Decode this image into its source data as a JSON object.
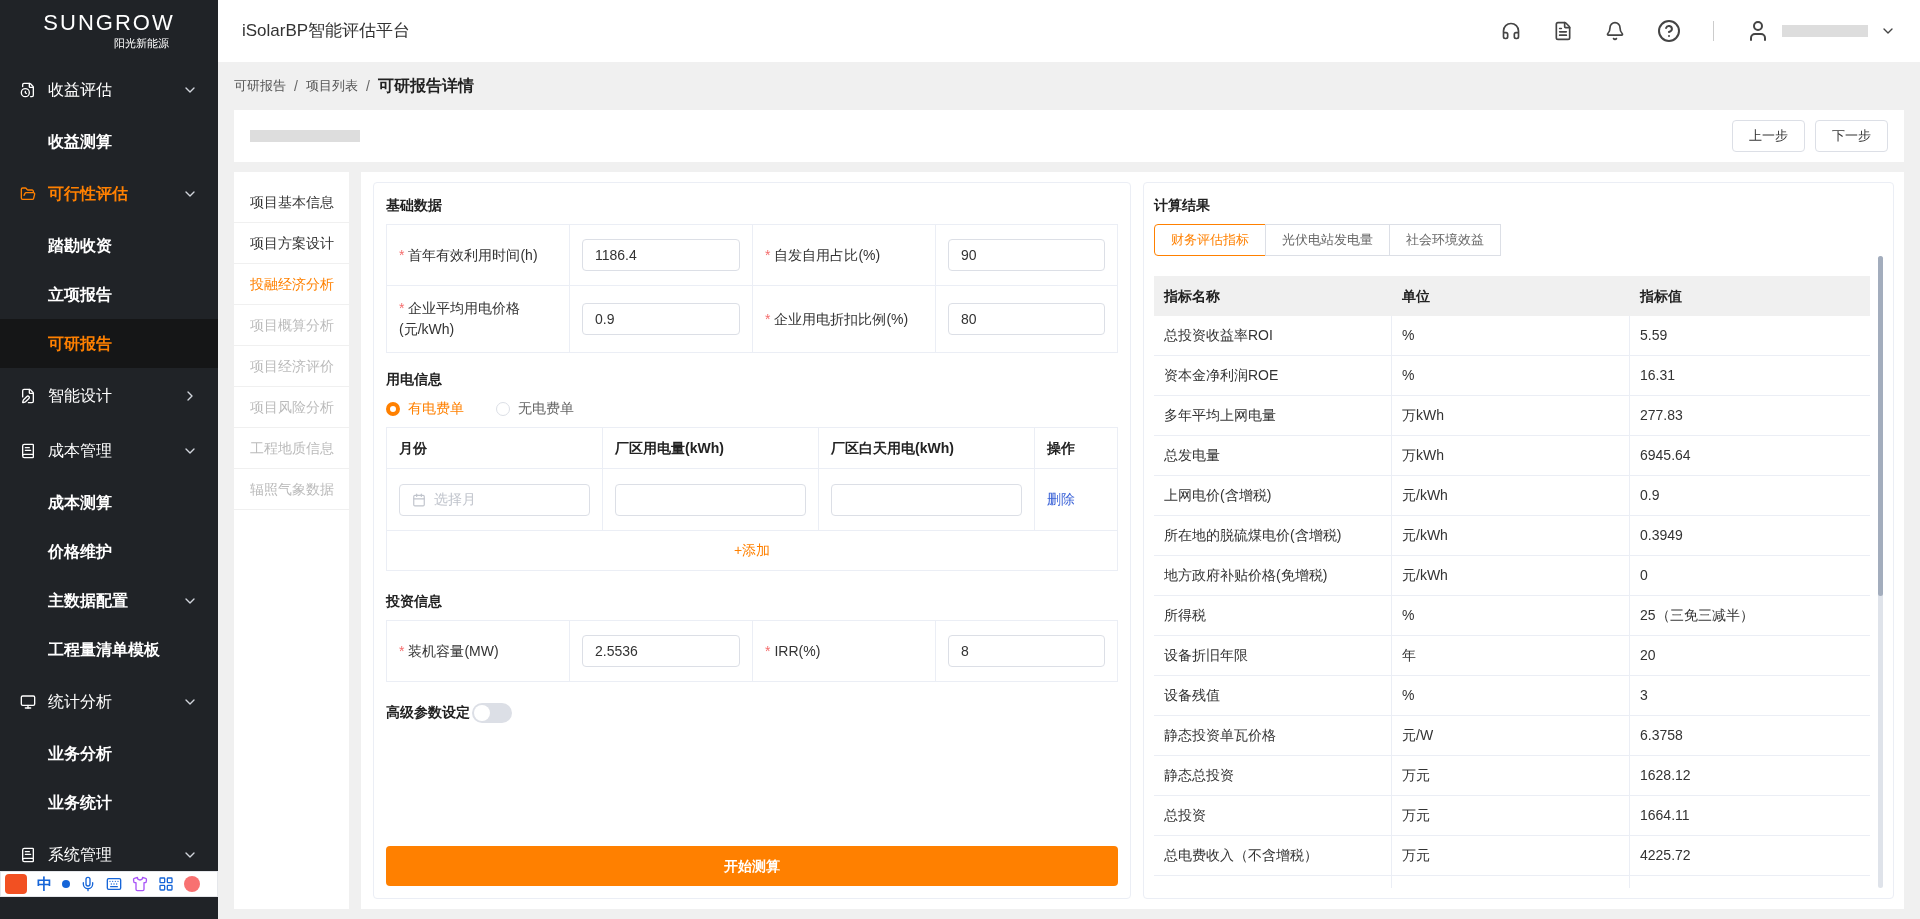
{
  "logo": {
    "name": "SUNGROW",
    "tagline": "阳光新能源"
  },
  "sidebar": {
    "items": [
      {
        "label": "收益评估",
        "expanded": true,
        "selected": false,
        "children": [
          {
            "label": "收益测算",
            "selected": false
          }
        ]
      },
      {
        "label": "可行性评估",
        "expanded": true,
        "selected": true,
        "children": [
          {
            "label": "踏勘收资",
            "selected": false
          },
          {
            "label": "立项报告",
            "selected": false
          },
          {
            "label": "可研报告",
            "selected": true
          }
        ]
      },
      {
        "label": "智能设计",
        "expanded": false,
        "selected": false
      },
      {
        "label": "成本管理",
        "expanded": true,
        "selected": false,
        "children": [
          {
            "label": "成本测算",
            "selected": false
          },
          {
            "label": "价格维护",
            "selected": false
          },
          {
            "label": "主数据配置",
            "selected": false,
            "expanded": true
          },
          {
            "label": "工程量清单模板",
            "selected": false
          }
        ]
      },
      {
        "label": "统计分析",
        "expanded": true,
        "selected": false,
        "children": [
          {
            "label": "业务分析",
            "selected": false
          },
          {
            "label": "业务统计",
            "selected": false
          }
        ]
      },
      {
        "label": "系统管理",
        "expanded": true,
        "selected": false
      }
    ]
  },
  "ime_bar": {
    "mode": "中"
  },
  "header": {
    "title": "iSolarBP智能评估平台"
  },
  "breadcrumb": [
    {
      "label": "可研报告"
    },
    {
      "separator": "/",
      "label": "项目列表"
    },
    {
      "separator": "/",
      "label": "可研报告详情"
    }
  ],
  "steps": {
    "buttons": [
      "上一步",
      "下一步"
    ]
  },
  "section_nav": [
    {
      "label": "项目基本信息",
      "selected": false,
      "disabled": false
    },
    {
      "label": "项目方案设计",
      "selected": false,
      "disabled": false
    },
    {
      "label": "投融经济分析",
      "selected": true,
      "disabled": false
    },
    {
      "label": "项目概算分析",
      "selected": false,
      "disabled": true
    },
    {
      "label": "项目经济评价",
      "selected": false,
      "disabled": true
    },
    {
      "label": "项目风险分析",
      "selected": false,
      "disabled": true
    },
    {
      "label": "工程地质信息",
      "selected": false,
      "disabled": true
    },
    {
      "label": "辐照气象数据",
      "selected": false,
      "disabled": true
    }
  ],
  "basic_data": {
    "title": "基础数据",
    "fields": [
      {
        "label": "首年有效利用时间(h)",
        "value": "1186.4",
        "required_mark": "*"
      },
      {
        "label": "自发自用占比(%)",
        "value": "90",
        "required_mark": "*"
      },
      {
        "label": "企业平均用电价格(元/kWh)",
        "value": "0.9",
        "required_mark": "*"
      },
      {
        "label": "企业用电折扣比例(%)",
        "value": "80",
        "required_mark": "*"
      }
    ]
  },
  "power_info": {
    "title": "用电信息",
    "options": [
      {
        "label": "有电费单",
        "selected": true
      },
      {
        "label": "无电费单",
        "selected": false
      }
    ],
    "columns": [
      "月份",
      "厂区用电量(kWh)",
      "厂区白天用电(kWh)",
      "操作"
    ],
    "row": {
      "month_placeholder": "选择月",
      "action": "删除"
    },
    "add": "+添加"
  },
  "investment": {
    "title": "投资信息",
    "fields": [
      {
        "label": "装机容量(MW)",
        "value": "2.5536",
        "required_mark": "*"
      },
      {
        "label": "IRR(%)",
        "value": "8",
        "required_mark": "*"
      }
    ]
  },
  "advanced": {
    "label": "高级参数设定",
    "on": false
  },
  "start_button": "开始测算",
  "results": {
    "title": "计算结果",
    "tabs": [
      {
        "label": "财务评估指标",
        "selected": true
      },
      {
        "label": "光伏电站发电量",
        "selected": false
      },
      {
        "label": "社会环境效益",
        "selected": false
      }
    ],
    "columns": [
      "指标名称",
      "单位",
      "指标值"
    ],
    "rows": [
      [
        "总投资收益率ROI",
        "%",
        "5.59"
      ],
      [
        "资本金净利润ROE",
        "%",
        "16.31"
      ],
      [
        "多年平均上网电量",
        "万kWh",
        "277.83"
      ],
      [
        "总发电量",
        "万kWh",
        "6945.64"
      ],
      [
        "上网电价(含增税)",
        "元/kWh",
        "0.9"
      ],
      [
        "所在地的脱硫煤电价(含增税)",
        "元/kWh",
        "0.3949"
      ],
      [
        "地方政府补贴价格(免增税)",
        "元/kWh",
        "0"
      ],
      [
        "所得税",
        "%",
        "25（三免三减半）"
      ],
      [
        "设备折旧年限",
        "年",
        "20"
      ],
      [
        "设备残值",
        "%",
        "3"
      ],
      [
        "静态投资单瓦价格",
        "元/W",
        "6.3758"
      ],
      [
        "静态总投资",
        "万元",
        "1628.12"
      ],
      [
        "总投资",
        "万元",
        "1664.11"
      ],
      [
        "总电费收入（不含增税）",
        "万元",
        "4225.72"
      ]
    ]
  }
}
